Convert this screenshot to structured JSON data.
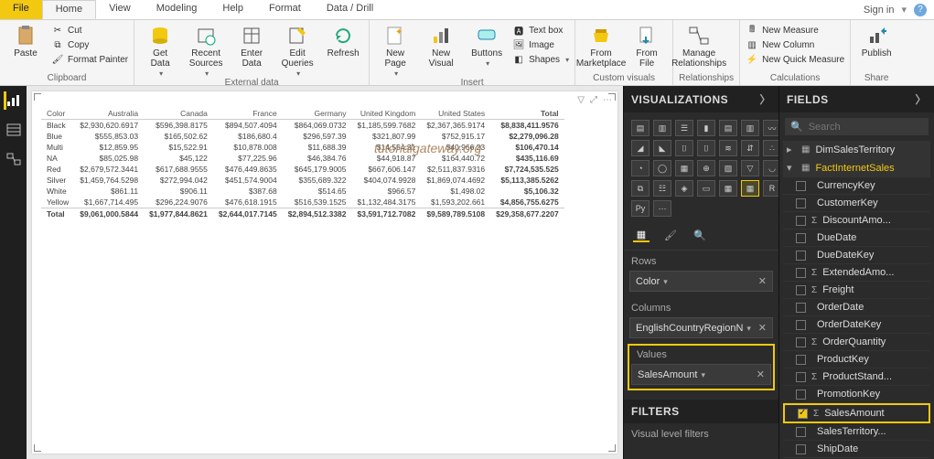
{
  "tabs": {
    "file": "File",
    "home": "Home",
    "view": "View",
    "modeling": "Modeling",
    "help": "Help",
    "format": "Format",
    "datadrill": "Data / Drill"
  },
  "signin": "Sign in",
  "ribbon": {
    "clipboard": {
      "paste": "Paste",
      "cut": "Cut",
      "copy": "Copy",
      "fp": "Format Painter",
      "label": "Clipboard"
    },
    "extdata": {
      "getdata": "Get\nData",
      "recent": "Recent\nSources",
      "enter": "Enter\nData",
      "edit": "Edit\nQueries",
      "refresh": "Refresh",
      "label": "External data"
    },
    "insert": {
      "newpage": "New\nPage",
      "newvisual": "New\nVisual",
      "buttons": "Buttons",
      "textbox": "Text box",
      "image": "Image",
      "shapes": "Shapes",
      "label": "Insert"
    },
    "custom": {
      "market": "From\nMarketplace",
      "file": "From\nFile",
      "label": "Custom visuals"
    },
    "rel": {
      "manage": "Manage\nRelationships",
      "label": "Relationships"
    },
    "calc": {
      "measure": "New Measure",
      "column": "New Column",
      "quick": "New Quick Measure",
      "label": "Calculations"
    },
    "share": {
      "publish": "Publish",
      "label": "Share"
    }
  },
  "matrix": {
    "cornerlabel": "Color",
    "cols": [
      "Australia",
      "Canada",
      "France",
      "Germany",
      "United Kingdom",
      "United States",
      "Total"
    ],
    "rows": [
      {
        "k": "Black",
        "v": [
          "$2,930,620.6917",
          "$596,398.8175",
          "$894,507.4094",
          "$864,069.0732",
          "$1,185,599.7682",
          "$2,367,365.9174",
          "$8,838,411.9576"
        ]
      },
      {
        "k": "Blue",
        "v": [
          "$555,853.03",
          "$165,502.62",
          "$186,680.4",
          "$296,597.39",
          "$321,807.99",
          "$752,915.17",
          "$2,279,096.28"
        ]
      },
      {
        "k": "Multi",
        "v": [
          "$12,859.95",
          "$15,522.91",
          "$10,878.008",
          "$11,688.39",
          "$14,554.31",
          "$40,966.23",
          "$106,470.14"
        ]
      },
      {
        "k": "NA",
        "v": [
          "$85,025.98",
          "$45,122",
          "$77,225.96",
          "$46,384.76",
          "$44,918.87",
          "$164,440.72",
          "$435,116.69"
        ]
      },
      {
        "k": "Red",
        "v": [
          "$2,679,572.3441",
          "$617,688.9555",
          "$476,449.8635",
          "$645,179.9005",
          "$667,606.147",
          "$2,511,837.9316",
          "$7,724,535.525"
        ]
      },
      {
        "k": "Silver",
        "v": [
          "$1,459,764.5298",
          "$272,994.042",
          "$451,574.9004",
          "$355,689.322",
          "$404,074.9928",
          "$1,869,074.4692",
          "$5,113,385.5262"
        ]
      },
      {
        "k": "White",
        "v": [
          "$861.11",
          "$906.11",
          "$387.68",
          "$514.65",
          "$966.57",
          "$1,498.02",
          "$5,106.32"
        ]
      },
      {
        "k": "Yellow",
        "v": [
          "$1,667,714.495",
          "$296,224.9076",
          "$476,618.1915",
          "$516,539.1525",
          "$1,132,484.3175",
          "$1,593,202.661",
          "$4,856,755.6275"
        ]
      }
    ],
    "totalrow": {
      "k": "Total",
      "v": [
        "$9,061,000.5844",
        "$1,977,844.8621",
        "$2,644,017.7145",
        "$2,894,512.3382",
        "$3,591,712.7082",
        "$9,589,789.5108",
        "$29,358,677.2207"
      ]
    }
  },
  "watermark": "tutorialgateway.org",
  "viz": {
    "title": "VISUALIZATIONS",
    "rows_label": "Rows",
    "rows_field": "Color",
    "cols_label": "Columns",
    "cols_field": "EnglishCountryRegionN",
    "vals_label": "Values",
    "vals_field": "SalesAmount",
    "filters_title": "FILTERS",
    "filters_sub": "Visual level filters"
  },
  "fields": {
    "title": "FIELDS",
    "search_ph": "Search",
    "tables": {
      "t1": "DimSalesTerritory",
      "t2": "FactInternetSales"
    },
    "cols": [
      "CurrencyKey",
      "CustomerKey",
      "DiscountAmo...",
      "DueDate",
      "DueDateKey",
      "ExtendedAmo...",
      "Freight",
      "OrderDate",
      "OrderDateKey",
      "OrderQuantity",
      "ProductKey",
      "ProductStand...",
      "PromotionKey",
      "SalesAmount",
      "SalesTerritory...",
      "ShipDate"
    ]
  }
}
